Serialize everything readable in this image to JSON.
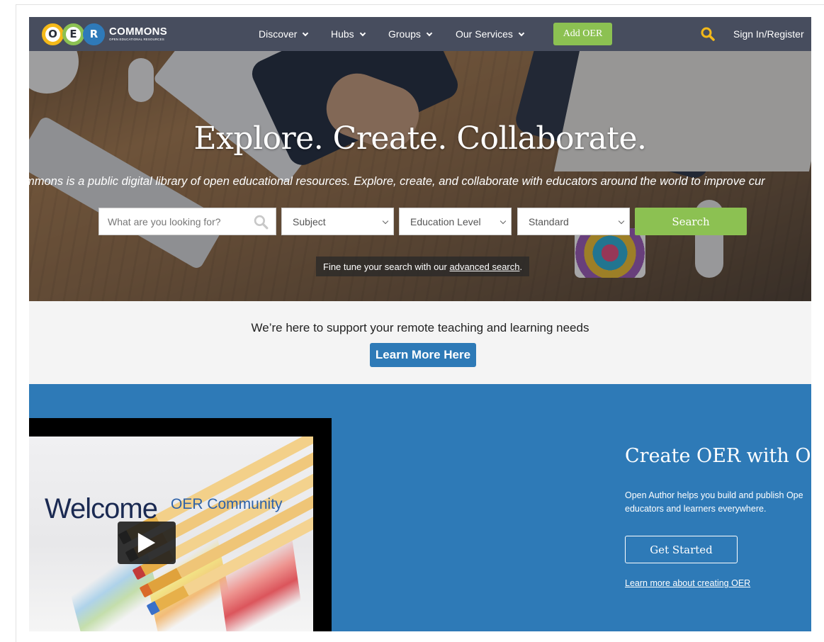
{
  "logo": {
    "letters": [
      "O",
      "E",
      "R"
    ],
    "name": "COMMONS",
    "subtitle": "OPEN EDUCATIONAL RESOURCES"
  },
  "nav": {
    "items": [
      {
        "label": "Discover"
      },
      {
        "label": "Hubs"
      },
      {
        "label": "Groups"
      },
      {
        "label": "Our Services"
      }
    ],
    "add_oer": "Add OER",
    "sign_in": "Sign In/Register"
  },
  "hero": {
    "title": "Explore. Create. Collaborate.",
    "tagline": "mmons is a public digital library of open educational resources. Explore, create, and collaborate with educators around the world to improve cur",
    "search_placeholder": "What are you looking for?",
    "subject": "Subject",
    "education_level": "Education Level",
    "standard": "Standard",
    "search_button": "Search",
    "finetune_prefix": "Fine tune your search with our ",
    "finetune_link": "advanced search",
    "finetune_suffix": "."
  },
  "support": {
    "text": "We’re here to support your remote teaching and learning needs",
    "button": "Learn More Here"
  },
  "video": {
    "welcome": "Welcome",
    "community": "OER Community"
  },
  "create": {
    "heading": "Create OER with Ope",
    "description": "Open Author helps you build and publish Ope educators and learners everywhere.",
    "button": "Get Started",
    "link": "Learn more about creating OER"
  },
  "colors": {
    "nav_bg": "#474d5e",
    "accent_green": "#8cc152",
    "accent_blue": "#2e7ab7",
    "logo_yellow": "#f4b919"
  }
}
